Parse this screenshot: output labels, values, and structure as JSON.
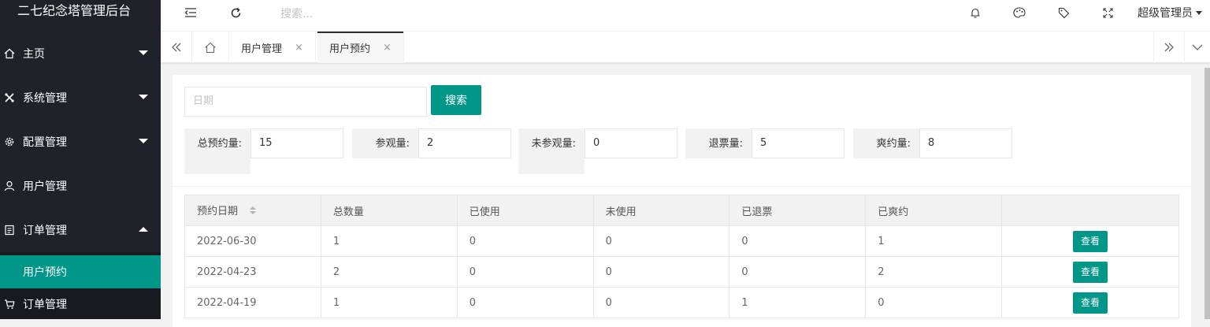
{
  "sidebar": {
    "logo": "二七纪念塔管理后台",
    "items": [
      {
        "label": "主页",
        "icon": "home-icon"
      },
      {
        "label": "系统管理",
        "icon": "tools-icon"
      },
      {
        "label": "配置管理",
        "icon": "gear-icon"
      },
      {
        "label": "用户管理",
        "icon": "user-icon"
      },
      {
        "label": "订单管理",
        "icon": "order-icon"
      }
    ],
    "sub_items": [
      {
        "label": "用户预约"
      },
      {
        "label": "订单管理",
        "icon": "cart-icon"
      }
    ]
  },
  "header": {
    "search_placeholder": "搜索...",
    "user": "超级管理员"
  },
  "tabs": [
    {
      "label": "用户管理",
      "close": "×"
    },
    {
      "label": "用户预约",
      "close": "×"
    }
  ],
  "filter": {
    "date_placeholder": "日期",
    "search_button": "搜索"
  },
  "stats": [
    {
      "label": "总预约量:",
      "value": "15"
    },
    {
      "label": "参观量:",
      "value": "2"
    },
    {
      "label": "未参观量:",
      "value": "0"
    },
    {
      "label": "退票量:",
      "value": "5"
    },
    {
      "label": "爽约量:",
      "value": "8"
    }
  ],
  "table": {
    "headers": [
      "预约日期",
      "总数量",
      "已使用",
      "未使用",
      "已退票",
      "已爽约",
      ""
    ],
    "rows": [
      [
        "2022-06-30",
        "1",
        "0",
        "0",
        "0",
        "1",
        "查看"
      ],
      [
        "2022-04-23",
        "2",
        "0",
        "0",
        "0",
        "2",
        "查看"
      ],
      [
        "2022-04-19",
        "1",
        "0",
        "0",
        "1",
        "0",
        "查看"
      ]
    ]
  },
  "colors": {
    "accent": "#009688",
    "sidebar_bg": "#20222a"
  }
}
